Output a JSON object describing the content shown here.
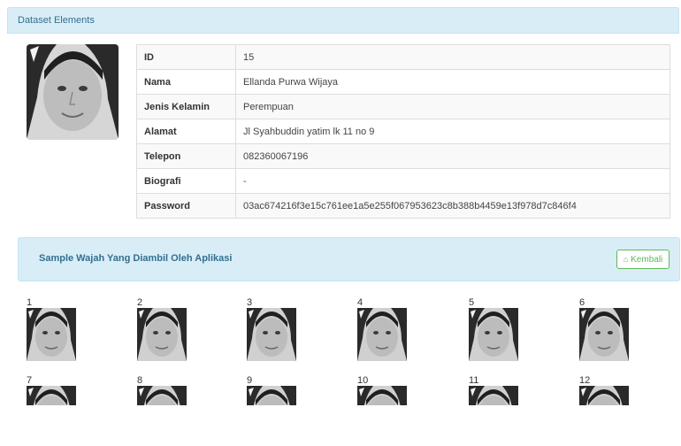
{
  "panel": {
    "title": "Dataset Elements"
  },
  "profile": {
    "rows": [
      {
        "label": "ID",
        "value": "15"
      },
      {
        "label": "Nama",
        "value": "Ellanda Purwa Wijaya"
      },
      {
        "label": "Jenis Kelamin",
        "value": "Perempuan"
      },
      {
        "label": "Alamat",
        "value": "Jl Syahbuddin yatim lk 11 no 9"
      },
      {
        "label": "Telepon",
        "value": "082360067196"
      },
      {
        "label": "Biografi",
        "value": "-"
      },
      {
        "label": "Password",
        "value": "03ac674216f3e15c761ee1a5e255f067953623c8b388b4459e13f978d7c846f4"
      }
    ]
  },
  "samples": {
    "title": "Sample Wajah Yang Diambil Oleh Aplikasi",
    "back_label": "Kembali",
    "back_icon": "home-icon",
    "items": [
      {
        "number": "1"
      },
      {
        "number": "2"
      },
      {
        "number": "3"
      },
      {
        "number": "4"
      },
      {
        "number": "5"
      },
      {
        "number": "6"
      },
      {
        "number": "7"
      },
      {
        "number": "8"
      },
      {
        "number": "9"
      },
      {
        "number": "10"
      },
      {
        "number": "11"
      },
      {
        "number": "12"
      }
    ]
  },
  "colors": {
    "panel_heading_bg": "#d9edf7",
    "panel_text": "#31708f",
    "success": "#5cb85c"
  }
}
